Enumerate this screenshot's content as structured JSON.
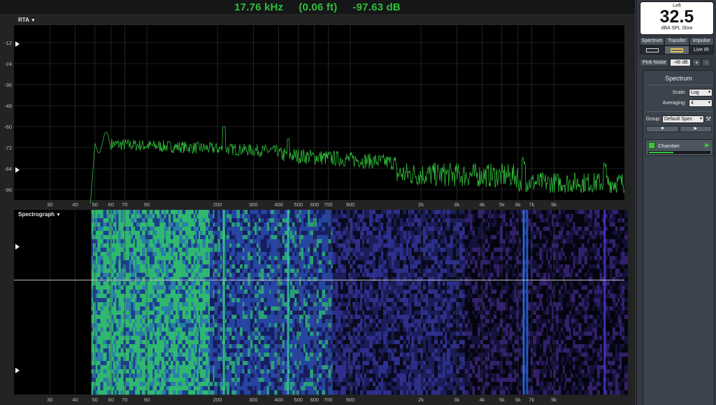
{
  "readout": {
    "frequency": "17.76 kHz",
    "distance": "(0.06 ft)",
    "level": "-97.63 dB"
  },
  "rta": {
    "title": "RTA",
    "db_ticks": [
      "-12",
      "-24",
      "-36",
      "-48",
      "-60",
      "-72",
      "-84",
      "-96"
    ],
    "markers_db": [
      -12,
      -84
    ],
    "trace_color": "#2fbf3a"
  },
  "spectrograph": {
    "title": "Spectrograph",
    "markers": [
      0.2,
      0.87
    ],
    "cursor": 0.38
  },
  "freq_axis": {
    "ticks": [
      30,
      40,
      50,
      60,
      70,
      90,
      200,
      300,
      400,
      500,
      600,
      700,
      900,
      2000,
      3000,
      4000,
      5000,
      6000,
      7000,
      9000
    ],
    "labels": [
      "30",
      "40",
      "50",
      "60",
      "70",
      "90",
      "200",
      "300",
      "400",
      "500",
      "600",
      "700",
      "900",
      "2k",
      "3k",
      "4k",
      "5k",
      "6k",
      "7k",
      "9k"
    ],
    "min_hz": 20,
    "max_hz": 20000,
    "scale": "log"
  },
  "meter": {
    "channel": "Left",
    "value": "32.5",
    "unit": "dBA SPL Slow"
  },
  "mode_tabs": [
    "Spectrum",
    "Transfer",
    "Impulse"
  ],
  "view": {
    "live_ir": "Live IR"
  },
  "generator": {
    "label": "Pink Noise",
    "level": "-48 dB",
    "plus": "+",
    "minus": "-"
  },
  "panel": {
    "title": "Spectrum",
    "scale_label": "Scale:",
    "scale_value": "Log",
    "averaging_label": "Averaging:",
    "averaging_value": "4",
    "group_label": "Group:",
    "group_value": "Default Spec",
    "stop_glyph": "■",
    "play_glyph": "▶"
  },
  "measurement": {
    "name": "Chamber",
    "level_fraction": 0.4,
    "color": "#3ec23e"
  }
}
